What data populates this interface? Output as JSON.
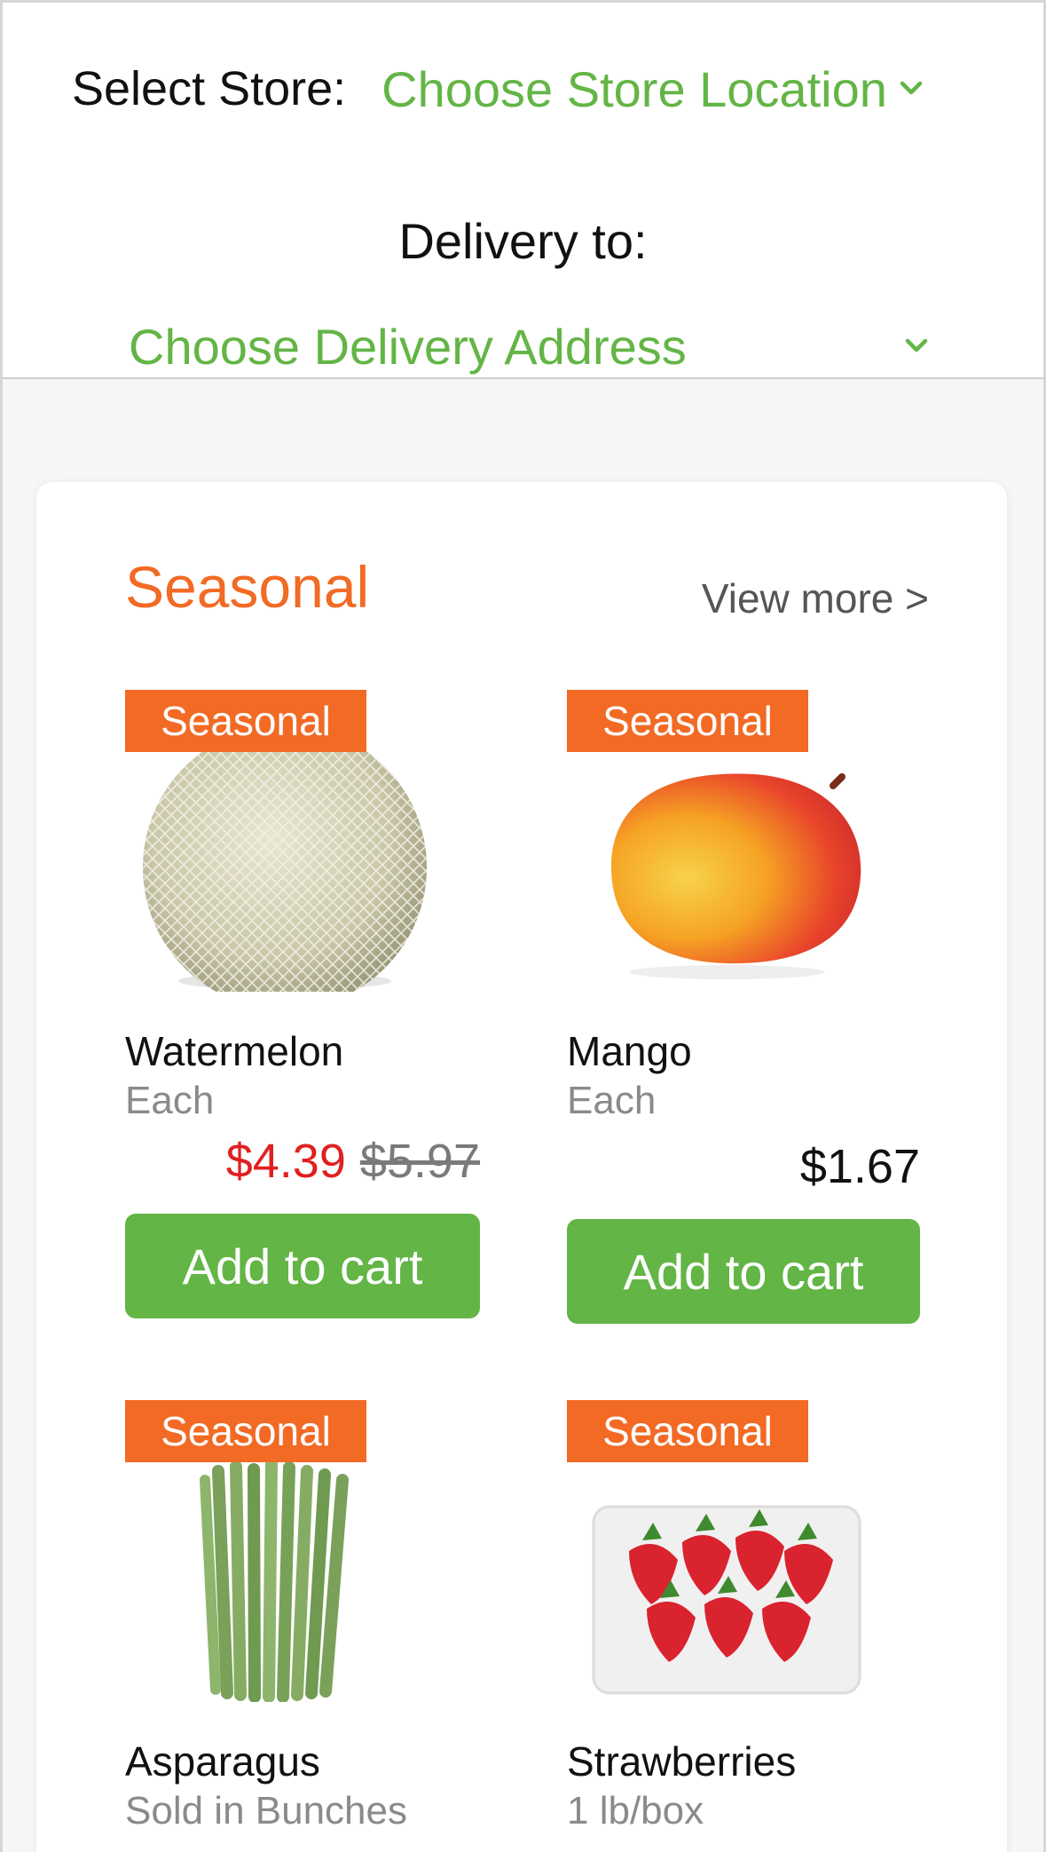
{
  "header": {
    "store_label": "Select Store:",
    "store_value": "Choose Store Location",
    "delivery_label": "Delivery to:",
    "delivery_value": "Choose Delivery Address"
  },
  "section": {
    "title": "Seasonal",
    "view_more": "View more >"
  },
  "products": [
    {
      "badge": "Seasonal",
      "name": "Watermelon",
      "unit": "Each",
      "price_sale": "$4.39",
      "price_old": "$5.97",
      "button": "Add to cart",
      "image": "cantaloupe-image"
    },
    {
      "badge": "Seasonal",
      "name": "Mango",
      "unit": "Each",
      "price": "$1.67",
      "button": "Add to cart",
      "image": "mango-image"
    },
    {
      "badge": "Seasonal",
      "name": "Asparagus",
      "unit": "Sold in Bunches",
      "image": "asparagus-image"
    },
    {
      "badge": "Seasonal",
      "name": "Strawberries",
      "unit": "1 lb/box",
      "image": "strawberries-image"
    }
  ],
  "colors": {
    "accent_green": "#63b546",
    "accent_orange": "#f26a24",
    "sale_red": "#e02020"
  },
  "icons": [
    "chevron-down-icon"
  ]
}
